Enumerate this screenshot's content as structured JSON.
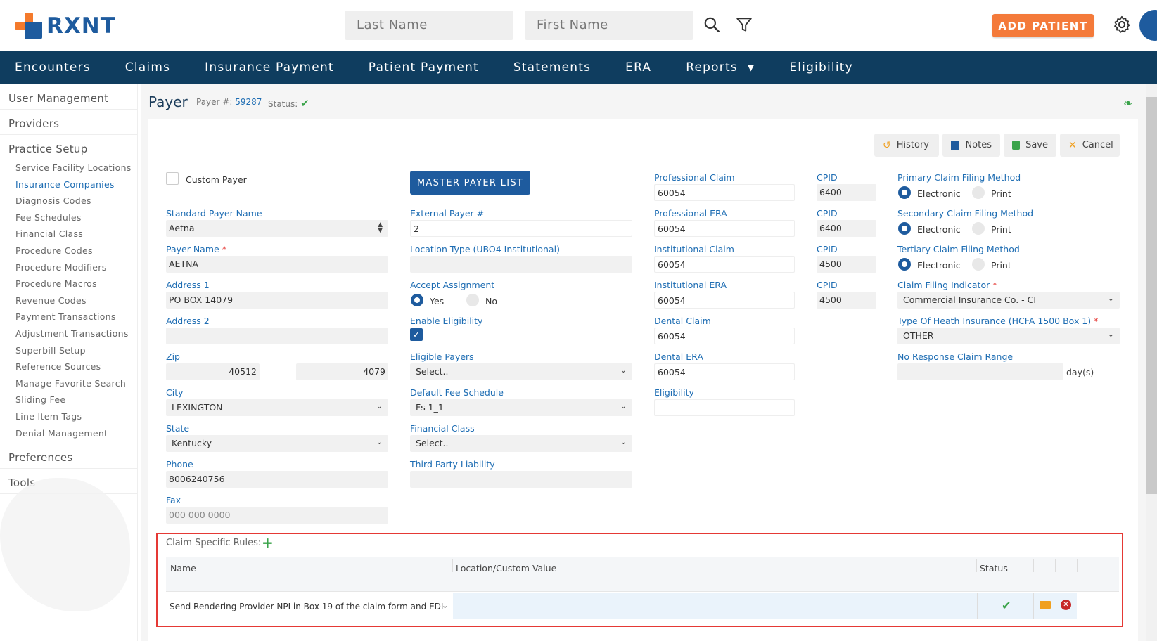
{
  "header": {
    "logo_text": "RXNT",
    "last_name_placeholder": "Last Name",
    "first_name_placeholder": "First Name",
    "add_patient_label": "ADD PATIENT"
  },
  "nav": {
    "items": [
      "Encounters",
      "Claims",
      "Insurance Payment",
      "Patient Payment",
      "Statements",
      "ERA",
      "Reports",
      "Eligibility"
    ]
  },
  "sidebar": {
    "sections": [
      "User Management",
      "Providers",
      "Practice Setup",
      "Preferences",
      "Tools"
    ],
    "practice_setup_items": [
      "Service Facility Locations",
      "Insurance Companies",
      "Diagnosis Codes",
      "Fee Schedules",
      "Financial Class",
      "Procedure Codes",
      "Procedure Modifiers",
      "Procedure Macros",
      "Revenue Codes",
      "Payment Transactions",
      "Adjustment Transactions",
      "Superbill Setup",
      "Reference Sources",
      "Manage Favorite Search",
      "Sliding Fee",
      "Line Item Tags",
      "Denial Management"
    ],
    "active_item": "Insurance Companies"
  },
  "page": {
    "title": "Payer",
    "payer_num_label": "Payer #:",
    "payer_num": "59287",
    "status_label": "Status:"
  },
  "toolbar": {
    "history": "History",
    "notes": "Notes",
    "save": "Save",
    "cancel": "Cancel"
  },
  "form": {
    "custom_payer_label": "Custom Payer",
    "master_payer_list": "MASTER PAYER LIST",
    "standard_payer_name_label": "Standard Payer Name",
    "standard_payer_name": "Aetna",
    "payer_name_label": "Payer Name",
    "payer_name": "AETNA",
    "address1_label": "Address 1",
    "address1": "PO BOX 14079",
    "address2_label": "Address 2",
    "address2": "",
    "zip_label": "Zip",
    "zip1": "40512",
    "zip_dash": "-",
    "zip2": "4079",
    "city_label": "City",
    "city": "LEXINGTON",
    "state_label": "State",
    "state": "Kentucky",
    "phone_label": "Phone",
    "phone": "8006240756",
    "fax_label": "Fax",
    "fax_placeholder": "000 000 0000",
    "external_payer_label": "External Payer #",
    "external_payer": "2",
    "location_type_label": "Location Type (UBO4 Institutional)",
    "location_type": "",
    "accept_assignment_label": "Accept Assignment",
    "yes": "Yes",
    "no": "No",
    "enable_eligibility_label": "Enable Eligibility",
    "eligible_payers_label": "Eligible Payers",
    "eligible_payers": "Select..",
    "default_fee_schedule_label": "Default Fee Schedule",
    "default_fee_schedule": "Fs 1_1",
    "financial_class_label": "Financial Class",
    "financial_class": "Select..",
    "third_party_liability_label": "Third Party Liability",
    "third_party_liability": "",
    "professional_claim_label": "Professional Claim",
    "professional_claim": "60054",
    "professional_era_label": "Professional ERA",
    "professional_era": "60054",
    "institutional_claim_label": "Institutional Claim",
    "institutional_claim": "60054",
    "institutional_era_label": "Institutional ERA",
    "institutional_era": "60054",
    "dental_claim_label": "Dental Claim",
    "dental_claim": "60054",
    "dental_era_label": "Dental ERA",
    "dental_era": "60054",
    "eligibility_label": "Eligibility",
    "eligibility": "",
    "cpid_label": "CPID",
    "cpid1": "6400",
    "cpid2": "6400",
    "cpid3": "4500",
    "cpid4": "4500",
    "primary_filing_label": "Primary Claim Filing Method",
    "secondary_filing_label": "Secondary Claim Filing Method",
    "tertiary_filing_label": "Tertiary Claim Filing Method",
    "electronic": "Electronic",
    "print": "Print",
    "claim_filing_indicator_label": "Claim Filing Indicator",
    "claim_filing_indicator": "Commercial Insurance Co. - CI",
    "type_of_health_ins_label": "Type Of Heath Insurance (HCFA 1500 Box 1)",
    "type_of_health_ins": "OTHER",
    "no_response_label": "No Response Claim Range",
    "no_response": "",
    "days_suffix": "day(s)"
  },
  "claim_rules": {
    "title": "Claim Specific Rules:",
    "columns": [
      "Name",
      "Location/Custom Value",
      "Status"
    ],
    "rows": [
      {
        "name": "Send Rendering Provider NPI in Box 19 of the claim form and EDI",
        "value": ""
      }
    ]
  },
  "colors": {
    "primary": "#1e5b9e",
    "nav": "#0f3d5f",
    "accent": "#f47a3a",
    "success": "#3aa34a",
    "danger": "#e53935"
  }
}
